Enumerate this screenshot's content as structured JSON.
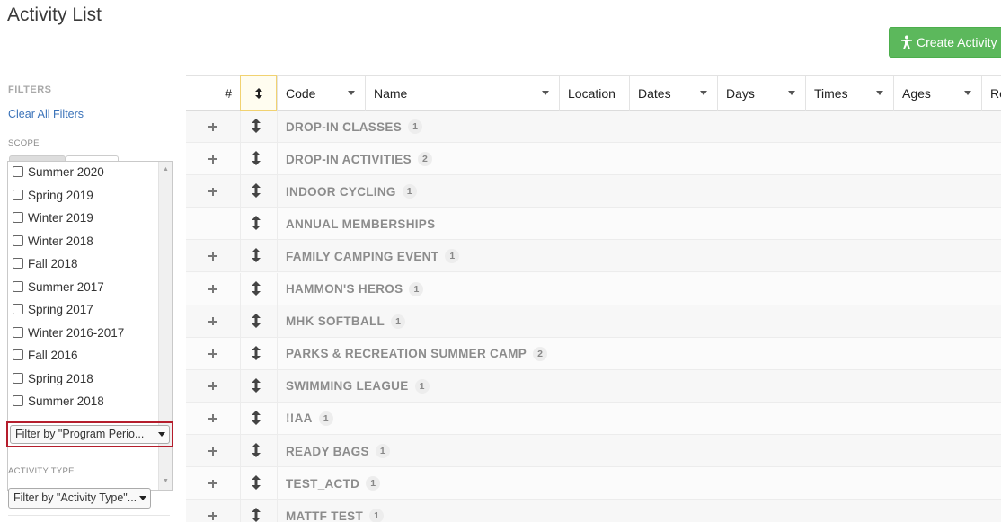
{
  "page": {
    "title": "Activity List"
  },
  "toolbar": {
    "create_label": "Create Activity",
    "create_icon": "person-icon",
    "create_color": "#5cb85c"
  },
  "sidebar": {
    "filters_heading": "FILTERS",
    "clear_all": "Clear All Filters",
    "scope_heading": "SCOPE",
    "scope_items": [
      {
        "label": "Summer 2020",
        "checked": false
      },
      {
        "label": "Spring 2019",
        "checked": false
      },
      {
        "label": "Winter 2019",
        "checked": false
      },
      {
        "label": "Winter 2018",
        "checked": false
      },
      {
        "label": "Fall 2018",
        "checked": false
      },
      {
        "label": "Summer 2017",
        "checked": false
      },
      {
        "label": "Spring 2017",
        "checked": false
      },
      {
        "label": "Winter 2016-2017",
        "checked": false
      },
      {
        "label": "Fall 2016",
        "checked": false
      },
      {
        "label": "Spring 2018",
        "checked": false
      },
      {
        "label": "Summer 2018",
        "checked": false
      }
    ],
    "program_filter": "Filter by \"Program Perio...",
    "activity_type_heading": "ACTIVITY TYPE",
    "activity_type_filter": "Filter by \"Activity Type\"...",
    "highlight_color": "#b51d2c"
  },
  "table": {
    "columns": {
      "hash": "#",
      "order": "↕",
      "code": "Code",
      "name": "Name",
      "location": "Location",
      "dates": "Dates",
      "days": "Days",
      "times": "Times",
      "ages": "Ages",
      "ro": "Ro"
    },
    "rows": [
      {
        "name": "DROP-IN CLASSES",
        "count": "1",
        "expandable": true
      },
      {
        "name": "DROP-IN ACTIVITIES",
        "count": "2",
        "expandable": true
      },
      {
        "name": "INDOOR CYCLING",
        "count": "1",
        "expandable": true
      },
      {
        "name": "ANNUAL MEMBERSHIPS",
        "count": "",
        "expandable": false
      },
      {
        "name": "FAMILY CAMPING EVENT",
        "count": "1",
        "expandable": true
      },
      {
        "name": "HAMMON'S HEROS",
        "count": "1",
        "expandable": true
      },
      {
        "name": "MHK SOFTBALL",
        "count": "1",
        "expandable": true
      },
      {
        "name": "PARKS & RECREATION SUMMER CAMP",
        "count": "2",
        "expandable": true
      },
      {
        "name": "SWIMMING LEAGUE",
        "count": "1",
        "expandable": true
      },
      {
        "name": "!!AA",
        "count": "1",
        "expandable": true
      },
      {
        "name": "READY BAGS",
        "count": "1",
        "expandable": true
      },
      {
        "name": "TEST_ACTD",
        "count": "1",
        "expandable": true
      },
      {
        "name": "MATTF TEST",
        "count": "1",
        "expandable": true
      }
    ]
  }
}
